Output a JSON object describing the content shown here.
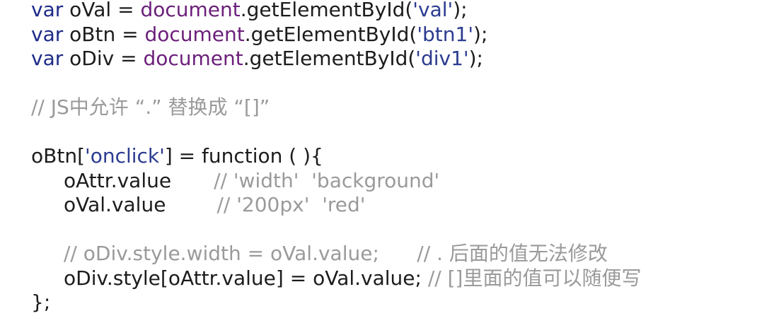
{
  "lines": {
    "l1": {
      "kw": "var",
      "rest1": " oVal = ",
      "doc": "document",
      ".get": ".getElementById(",
      "arg": "'val'",
      "end": ");"
    },
    "l2": {
      "kw": "var",
      "rest1": " oBtn = ",
      "doc": "document",
      ".get": ".getElementById(",
      "arg": "'btn1'",
      "end": ");"
    },
    "l3": {
      "kw": "var",
      "rest1": " oDiv = ",
      "doc": "document",
      ".get": ".getElementById(",
      "arg": "'div1'",
      "end": ");"
    },
    "l4": {
      "comment": "// JS中允许 “.” 替换成 “[]”"
    },
    "l5": {
      "a": "oBtn[",
      "s": "'onclick'",
      "b": "] = function ( ){"
    },
    "l6": {
      "code": "oAttr.value",
      "comment": "// 'width'  'background'"
    },
    "l7": {
      "code": "oVal.value",
      "comment": "// '200px'  'red'"
    },
    "l8": {
      "comment": "// oDiv.style.width = oVal.value;      // . 后面的值无法修改"
    },
    "l9": {
      "code": "oDiv.style[oAttr.value] = oVal.value; ",
      "comment": "// []里面的值可以随便写"
    },
    "l10": {
      "code": "};"
    }
  }
}
